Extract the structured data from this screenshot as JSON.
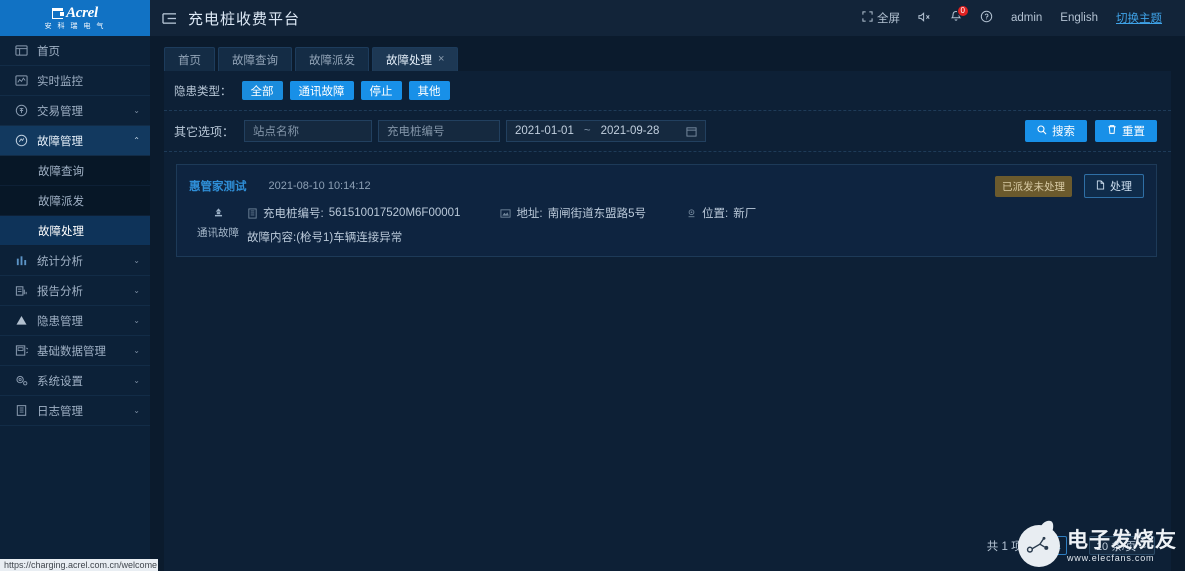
{
  "brand": {
    "name": "Acrel",
    "sub": "安 科 瑞 电 气"
  },
  "header": {
    "title": "充电桩收费平台",
    "fullscreen": "全屏",
    "user": "admin",
    "language": "English",
    "theme": "切换主题",
    "notification_count": "0"
  },
  "sidebar": {
    "items": [
      {
        "label": "首页",
        "icon": "home-icon",
        "arrow": "",
        "active": false
      },
      {
        "label": "实时监控",
        "icon": "monitor-icon",
        "arrow": "",
        "active": false
      },
      {
        "label": "交易管理",
        "icon": "transaction-icon",
        "arrow": "⌄",
        "active": false
      },
      {
        "label": "故障管理",
        "icon": "fault-icon",
        "arrow": "⌃",
        "active": true
      },
      {
        "label": "统计分析",
        "icon": "chart-icon",
        "arrow": "⌄",
        "active": false
      },
      {
        "label": "报告分析",
        "icon": "report-icon",
        "arrow": "⌄",
        "active": false
      },
      {
        "label": "隐患管理",
        "icon": "warning-icon",
        "arrow": "⌄",
        "active": false
      },
      {
        "label": "基础数据管理",
        "icon": "database-icon",
        "arrow": "⌄",
        "active": false
      },
      {
        "label": "系统设置",
        "icon": "gear-icon",
        "arrow": "⌄",
        "active": false
      },
      {
        "label": "日志管理",
        "icon": "log-icon",
        "arrow": "⌄",
        "active": false
      }
    ],
    "submenu": [
      {
        "label": "故障查询",
        "active": false
      },
      {
        "label": "故障派发",
        "active": false
      },
      {
        "label": "故障处理",
        "active": true
      }
    ]
  },
  "tabs": [
    {
      "label": "首页",
      "closable": false,
      "active": false
    },
    {
      "label": "故障查询",
      "closable": false,
      "active": false
    },
    {
      "label": "故障派发",
      "closable": false,
      "active": false
    },
    {
      "label": "故障处理",
      "closable": true,
      "close": "×",
      "active": true
    }
  ],
  "filters": {
    "type_label": "隐患类型：",
    "chips": [
      {
        "label": "全部",
        "selected": true
      },
      {
        "label": "通讯故障",
        "selected": false
      },
      {
        "label": "停止",
        "selected": false
      },
      {
        "label": "其他",
        "selected": false
      }
    ],
    "other_label": "其它选项：",
    "site_placeholder": "站点名称",
    "site_value": "",
    "pile_placeholder": "充电桩编号",
    "pile_value": "",
    "date_start": "2021-01-01",
    "date_sep": "~",
    "date_end": "2021-09-28",
    "search_button": "搜索",
    "reset_button": "重置"
  },
  "records": [
    {
      "station": "惠管家测试",
      "time": "2021-08-10 10:14:12",
      "status": "已派发未处理",
      "action": "处理",
      "fault_type": "通讯故障",
      "pile_label": "充电桩编号:",
      "pile_value": "561510017520M6F00001",
      "address_label": "地址:",
      "address_value": "南闸街道东盟路5号",
      "position_label": "位置:",
      "position_value": "新厂",
      "content": "故障内容:(枪号1)车辆连接异常"
    }
  ],
  "pagination": {
    "total": "共 1 项",
    "prev": "‹",
    "page": "1",
    "next": "›",
    "page_size": "10 条/页",
    "caret": "⌄"
  },
  "watermark": {
    "cn": "电子发烧友",
    "en": "www.elecfans.com"
  },
  "statusbar": {
    "url": "https://charging.acrel.com.cn/welcome"
  }
}
